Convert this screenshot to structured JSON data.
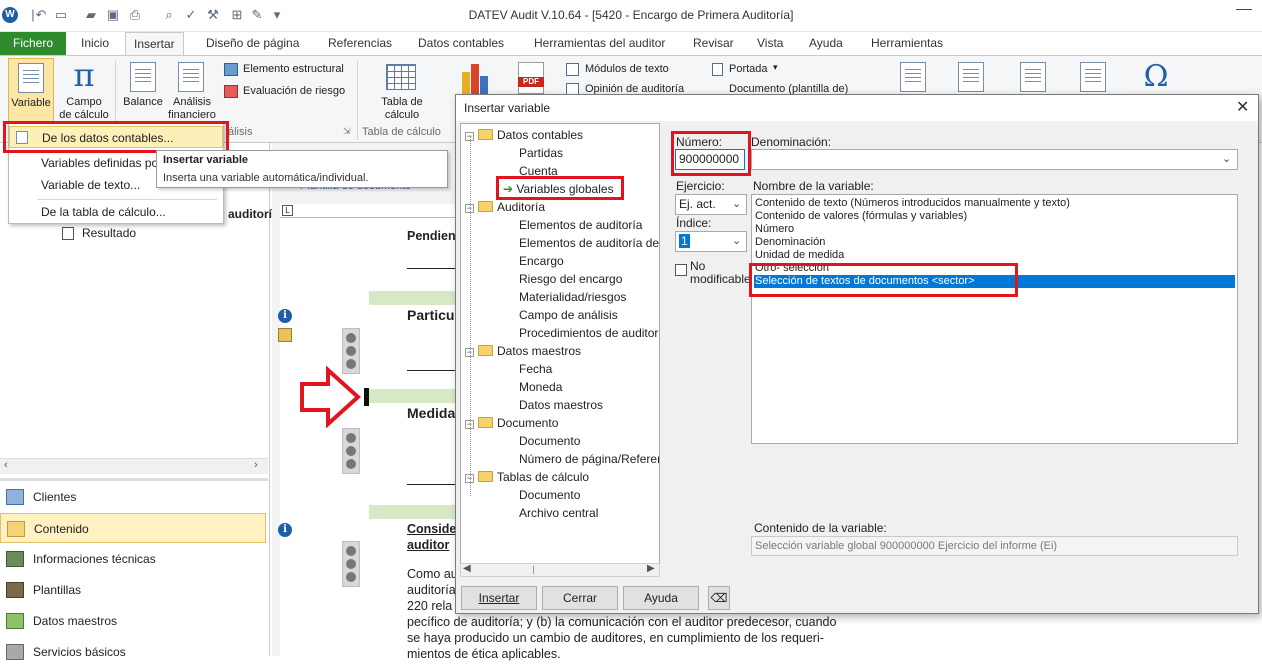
{
  "window": {
    "title": "DATEV Audit V.10.64 - [5420 - Encargo de Primera Auditoría]",
    "app_logo": "W"
  },
  "ribbon_tabs": [
    "Fichero",
    "Inicio",
    "Insertar",
    "Diseño de página",
    "Referencias",
    "Datos contables",
    "Herramientas del auditor",
    "Revisar",
    "Vista",
    "Ayuda",
    "Herramientas"
  ],
  "ribbon": {
    "variable": "Variable",
    "campo_calculo_1": "Campo",
    "campo_calculo_2": "de cálculo",
    "balance": "Balance",
    "analisis_1": "Análisis",
    "analisis_2": "financiero",
    "elemento_estructural": "Elemento estructural",
    "evaluacion_riesgo": "Evaluación de riesgo",
    "tabla_calculo_1": "Tabla de",
    "tabla_calculo_2": "cálculo",
    "group_tabla": "Tabla de cálculo",
    "group_analisis": "álisis",
    "modulos_texto": "Módulos de texto",
    "opinion_auditoria": "Opinión de auditoría",
    "portada": "Portada",
    "documento_plantilla": "Documento (plantilla de)"
  },
  "dropdown": {
    "items": [
      "De los datos contables...",
      "Variables definidas por",
      "Variable de texto...",
      "De la tabla de cálculo..."
    ]
  },
  "tooltip": {
    "title": "Insertar variable",
    "text": "Inserta una variable automática/individual."
  },
  "left_nav": {
    "tree_fragment": "auditoría",
    "tree_item": "Resultado",
    "items": [
      "Clientes",
      "Contenido",
      "Informaciones técnicas",
      "Plantillas",
      "Datos maestros",
      "Servicios básicos"
    ]
  },
  "document": {
    "tab": "Plantilla de documento",
    "headings": [
      "Pendient",
      "Particu",
      "Medida",
      "Conside",
      "auditor"
    ],
    "paragraph": [
      "Como au",
      "auditoría",
      "220 rela",
      "pecífico de auditoría; y (b) la comunicación con el auditor predecesor, cuando",
      "se haya producido un cambio de auditores, en cumplimiento de los requeri-",
      "mientos de ética aplicables."
    ]
  },
  "dialog": {
    "title": "Insertar variable",
    "tree": [
      {
        "label": "Datos contables",
        "level": 0,
        "type": "folder"
      },
      {
        "label": "Partidas",
        "level": 1,
        "type": "item"
      },
      {
        "label": "Cuenta",
        "level": 1,
        "type": "item"
      },
      {
        "label": "Variables globales",
        "level": 1,
        "type": "selected"
      },
      {
        "label": "Auditoría",
        "level": 0,
        "type": "folder"
      },
      {
        "label": "Elementos de auditoría",
        "level": 1,
        "type": "item"
      },
      {
        "label": "Elementos de auditoría del",
        "level": 1,
        "type": "item"
      },
      {
        "label": "Encargo",
        "level": 1,
        "type": "item"
      },
      {
        "label": "Riesgo del encargo",
        "level": 1,
        "type": "item"
      },
      {
        "label": "Materialidad/riesgos",
        "level": 1,
        "type": "item"
      },
      {
        "label": "Campo de análisis",
        "level": 1,
        "type": "item"
      },
      {
        "label": "Procedimientos de auditor",
        "level": 1,
        "type": "item"
      },
      {
        "label": "Datos maestros",
        "level": 0,
        "type": "folder"
      },
      {
        "label": "Fecha",
        "level": 1,
        "type": "item"
      },
      {
        "label": "Moneda",
        "level": 1,
        "type": "item"
      },
      {
        "label": "Datos maestros",
        "level": 1,
        "type": "item"
      },
      {
        "label": "Documento",
        "level": 0,
        "type": "folder"
      },
      {
        "label": "Documento",
        "level": 1,
        "type": "item"
      },
      {
        "label": "Número de página/Referen",
        "level": 1,
        "type": "item"
      },
      {
        "label": "Tablas de cálculo",
        "level": 0,
        "type": "folder"
      },
      {
        "label": "Documento",
        "level": 1,
        "type": "item"
      },
      {
        "label": "Archivo central",
        "level": 1,
        "type": "item"
      }
    ],
    "numero_label": "Número:",
    "numero_value": "900000000",
    "denominacion_label": "Denominación:",
    "denominacion_value": "",
    "ejercicio_label": "Ejercicio:",
    "ejercicio_value": "Ej. act.",
    "indice_label": "Índice:",
    "indice_value": "1",
    "no_modificable_1": "No",
    "no_modificable_2": "modificable",
    "nombre_label": "Nombre de la variable:",
    "nombres": [
      "Contenido de texto (Números introducidos manualmente y texto)",
      "Contenido de valores (fórmulas y variables)",
      "Número",
      "Denominación",
      "Unidad de medida",
      "Otro- selección",
      "Selección de textos de documentos <sector>"
    ],
    "contenido_label": "Contenido de la variable:",
    "contenido_value": "Selección variable global 900000000 Ejercicio del informe (Ei)",
    "buttons": {
      "insertar": "Insertar",
      "cerrar": "Cerrar",
      "ayuda": "Ayuda"
    }
  },
  "colors": {
    "fichero_green": "#2e8b2e",
    "highlight_red": "#e2141e",
    "selection_blue": "#0078d7",
    "menu_hover": "#fcefb8"
  }
}
